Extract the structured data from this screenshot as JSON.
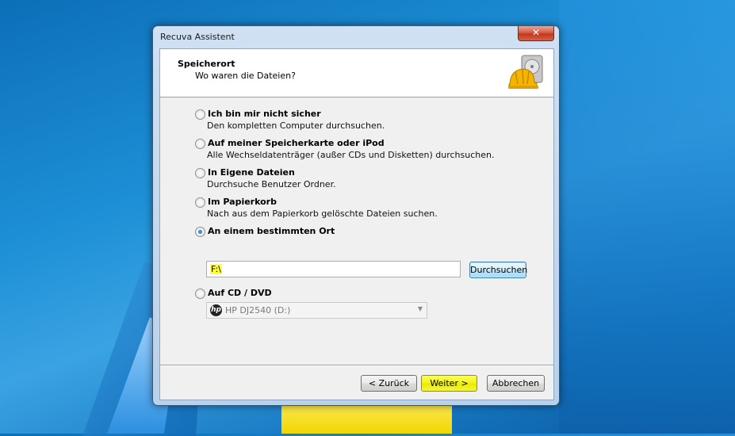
{
  "window": {
    "title": "Recuva Assistent",
    "close_symbol": "✕"
  },
  "header": {
    "title": "Speicherort",
    "subtitle": "Wo waren die Dateien?",
    "icon": "recuva-hardhat-drive-icon"
  },
  "options": [
    {
      "label": "Ich bin mir nicht sicher",
      "description": "Den kompletten Computer durchsuchen.",
      "checked": false
    },
    {
      "label": "Auf meiner Speicherkarte oder iPod",
      "description": "Alle Wechseldatenträger (außer CDs und Disketten) durchsuchen.",
      "checked": false
    },
    {
      "label": "In Eigene Dateien",
      "description": "Durchsuche Benutzer Ordner.",
      "checked": false
    },
    {
      "label": "Im Papierkorb",
      "description": "Nach aus dem Papierkorb gelöschte Dateien suchen.",
      "checked": false
    },
    {
      "label": "An einem bestimmten Ort",
      "checked": true
    },
    {
      "label": "Auf CD / DVD",
      "checked": false
    }
  ],
  "location": {
    "path_value": "F:\\",
    "browse_label": "Durchsuchen"
  },
  "dvd": {
    "selected": "HP DJ2540 (D:)",
    "logo_text": "hp"
  },
  "footer": {
    "back_label": "< Zurück",
    "next_label": "Weiter >",
    "cancel_label": "Abbrechen"
  },
  "colors": {
    "highlight": "#ffff3c",
    "desktop": "#1d8fd6"
  }
}
